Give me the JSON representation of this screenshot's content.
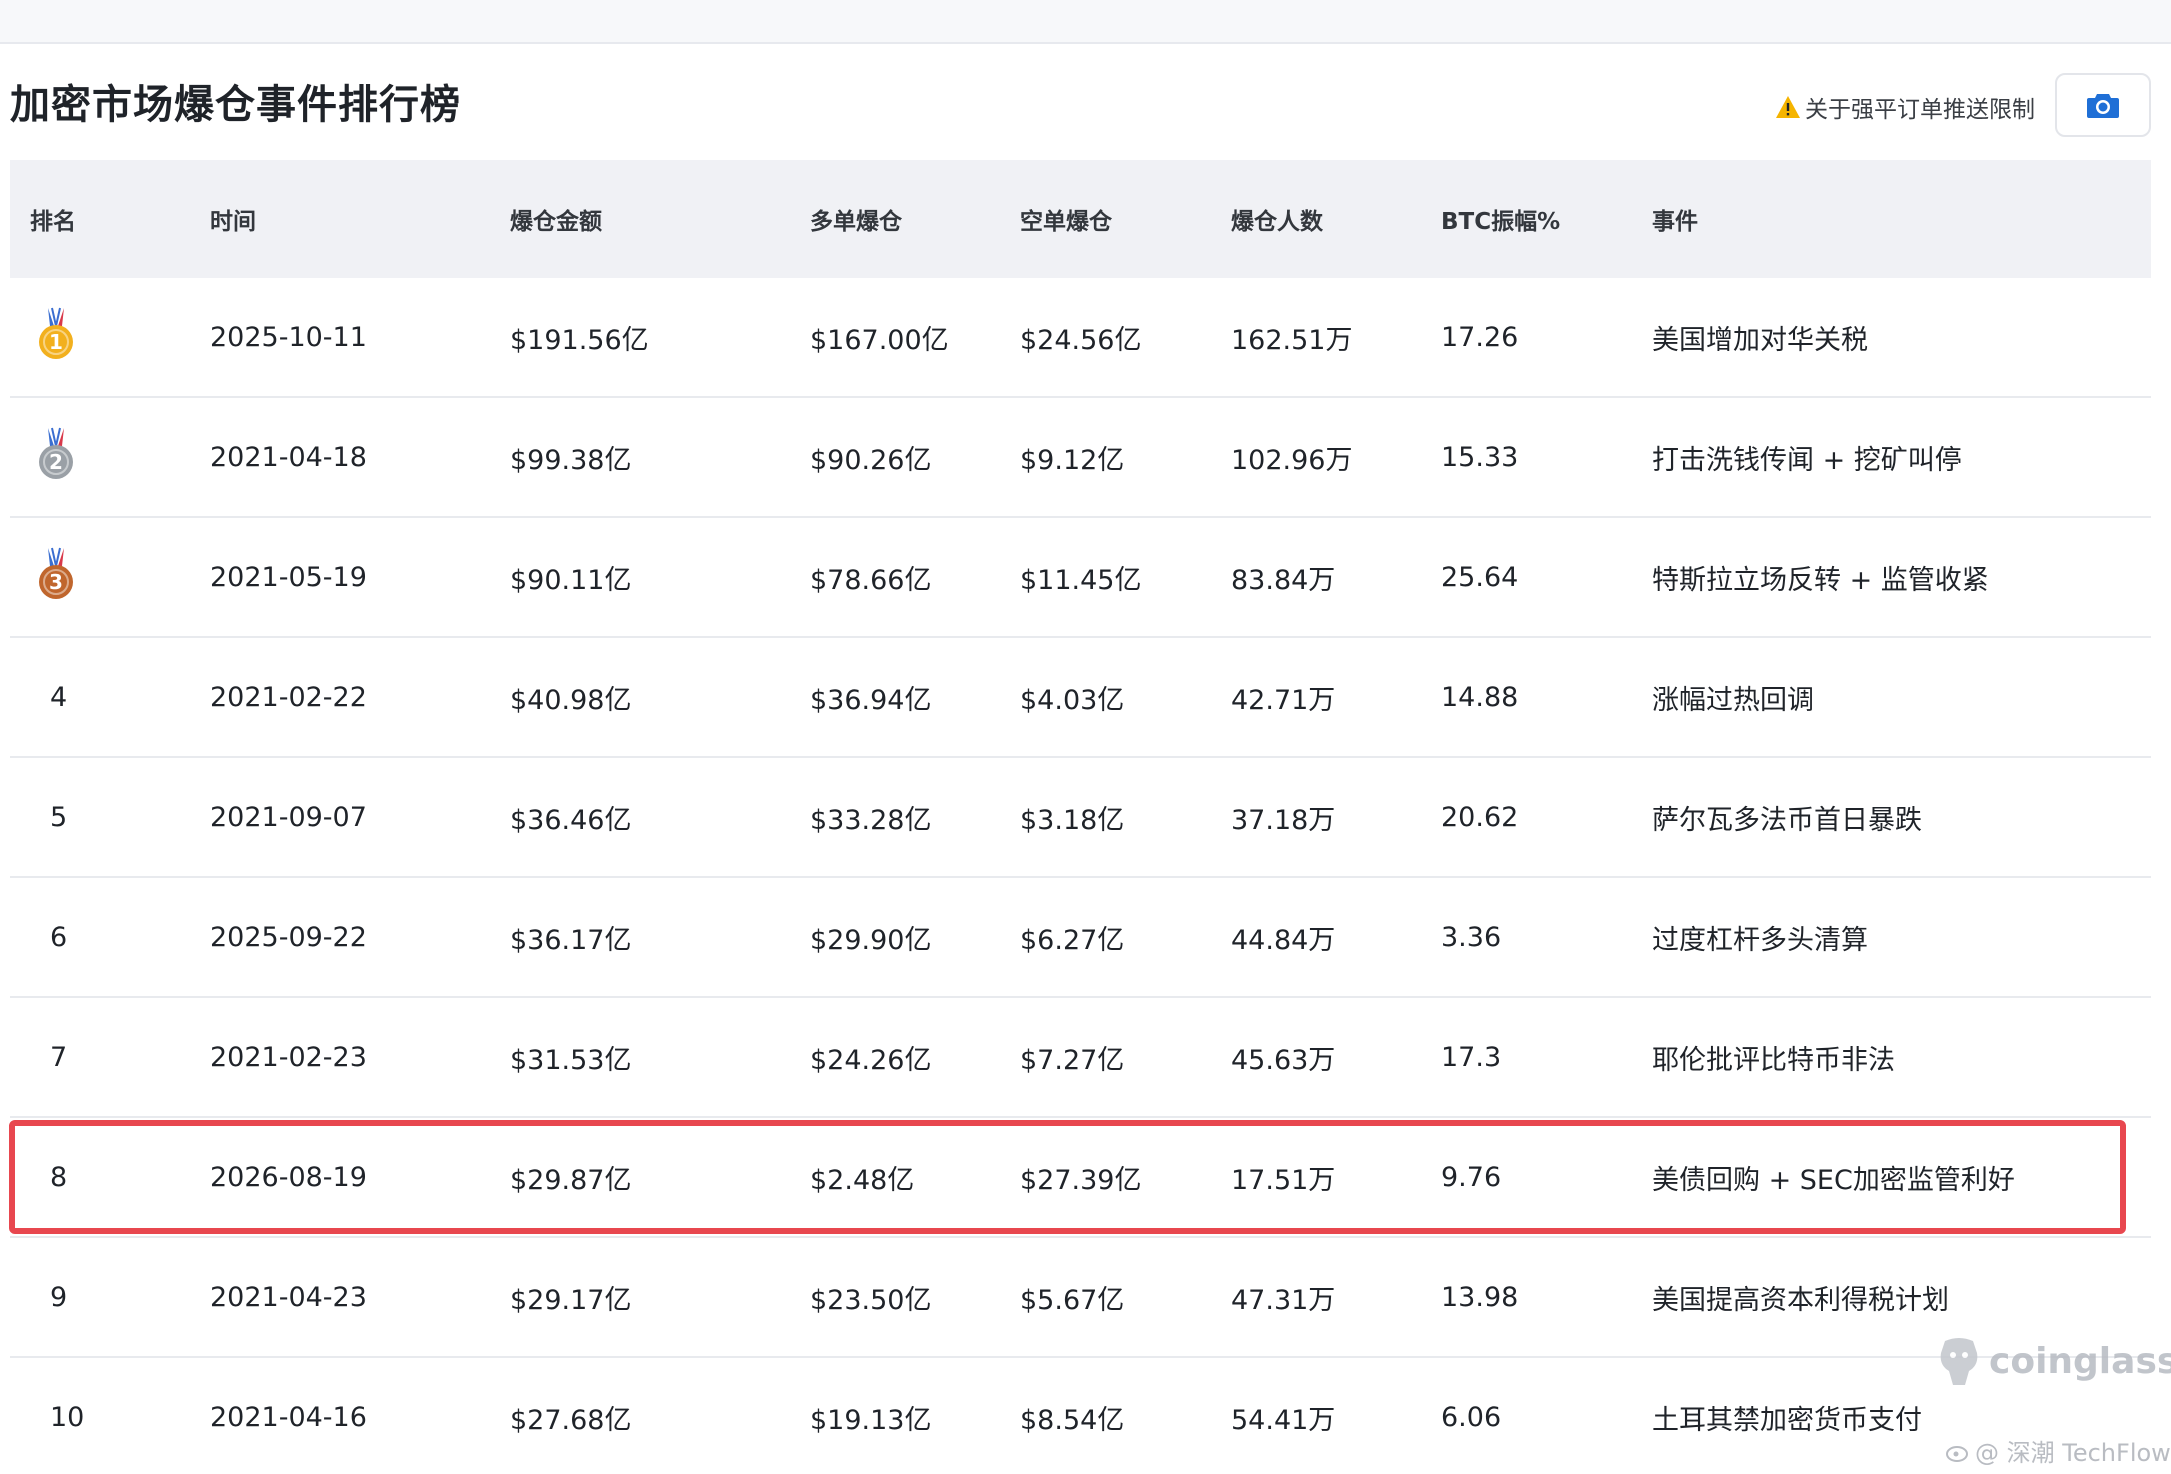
{
  "header": {
    "title": "加密市场爆仓事件排行榜",
    "notice_label": "关于强平订单推送限制",
    "camera_icon": "camera-icon",
    "warning_icon": "warning-icon"
  },
  "colors": {
    "highlight": "#e8474f",
    "header_bg": "#f0f1f5",
    "camera_blue": "#1f6fd6",
    "gold": "#f2b01e",
    "silver": "#9aa0a6",
    "bronze": "#c0662d"
  },
  "table": {
    "columns": [
      "排名",
      "时间",
      "爆仓金额",
      "多单爆仓",
      "空单爆仓",
      "爆仓人数",
      "BTC振幅%",
      "事件"
    ],
    "rows": [
      {
        "rank": "1",
        "medal": "gold",
        "date": "2025-10-11",
        "total": "$191.56亿",
        "long": "$167.00亿",
        "short": "$24.56亿",
        "people": "162.51万",
        "btc": "17.26",
        "event": "美国增加对华关税"
      },
      {
        "rank": "2",
        "medal": "silver",
        "date": "2021-04-18",
        "total": "$99.38亿",
        "long": "$90.26亿",
        "short": "$9.12亿",
        "people": "102.96万",
        "btc": "15.33",
        "event": "打击洗钱传闻 + 挖矿叫停"
      },
      {
        "rank": "3",
        "medal": "bronze",
        "date": "2021-05-19",
        "total": "$90.11亿",
        "long": "$78.66亿",
        "short": "$11.45亿",
        "people": "83.84万",
        "btc": "25.64",
        "event": "特斯拉立场反转 + 监管收紧"
      },
      {
        "rank": "4",
        "medal": "",
        "date": "2021-02-22",
        "total": "$40.98亿",
        "long": "$36.94亿",
        "short": "$4.03亿",
        "people": "42.71万",
        "btc": "14.88",
        "event": "涨幅过热回调"
      },
      {
        "rank": "5",
        "medal": "",
        "date": "2021-09-07",
        "total": "$36.46亿",
        "long": "$33.28亿",
        "short": "$3.18亿",
        "people": "37.18万",
        "btc": "20.62",
        "event": "萨尔瓦多法币首日暴跌"
      },
      {
        "rank": "6",
        "medal": "",
        "date": "2025-09-22",
        "total": "$36.17亿",
        "long": "$29.90亿",
        "short": "$6.27亿",
        "people": "44.84万",
        "btc": "3.36",
        "event": "过度杠杆多头清算"
      },
      {
        "rank": "7",
        "medal": "",
        "date": "2021-02-23",
        "total": "$31.53亿",
        "long": "$24.26亿",
        "short": "$7.27亿",
        "people": "45.63万",
        "btc": "17.3",
        "event": "耶伦批评比特币非法"
      },
      {
        "rank": "8",
        "medal": "",
        "date": "2026-08-19",
        "total": "$29.87亿",
        "long": "$2.48亿",
        "short": "$27.39亿",
        "people": "17.51万",
        "btc": "9.76",
        "event": "美债回购 + SEC加密监管利好"
      },
      {
        "rank": "9",
        "medal": "",
        "date": "2021-04-23",
        "total": "$29.17亿",
        "long": "$23.50亿",
        "short": "$5.67亿",
        "people": "47.31万",
        "btc": "13.98",
        "event": "美国提高资本利得税计划"
      },
      {
        "rank": "10",
        "medal": "",
        "date": "2021-04-16",
        "total": "$27.68亿",
        "long": "$19.13亿",
        "short": "$8.54亿",
        "people": "54.41万",
        "btc": "6.06",
        "event": "土耳其禁加密货币支付"
      }
    ]
  },
  "watermark": {
    "logo_text": "coinglass",
    "credit_text": "@ 深潮 TechFlow"
  }
}
